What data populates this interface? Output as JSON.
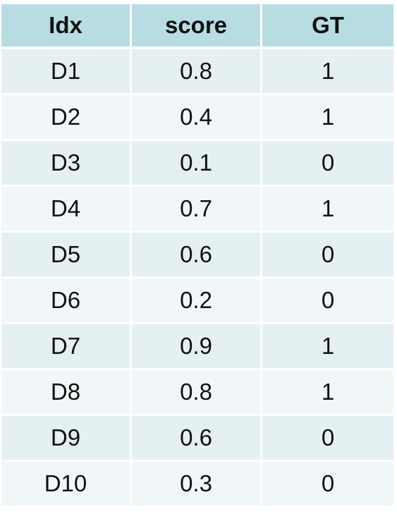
{
  "table": {
    "columns": [
      "Idx",
      "score",
      "GT"
    ],
    "rows": [
      [
        "D1",
        "0.8",
        "1"
      ],
      [
        "D2",
        "0.4",
        "1"
      ],
      [
        "D3",
        "0.1",
        "0"
      ],
      [
        "D4",
        "0.7",
        "1"
      ],
      [
        "D5",
        "0.6",
        "0"
      ],
      [
        "D6",
        "0.2",
        "0"
      ],
      [
        "D7",
        "0.9",
        "1"
      ],
      [
        "D8",
        "0.8",
        "1"
      ],
      [
        "D9",
        "0.6",
        "0"
      ],
      [
        "D10",
        "0.3",
        "0"
      ]
    ]
  },
  "colors": {
    "header_bg": "#b7dde2",
    "row_odd_bg": "#e4f0f2",
    "row_even_bg": "#f1f7f9",
    "text": "#111111"
  }
}
